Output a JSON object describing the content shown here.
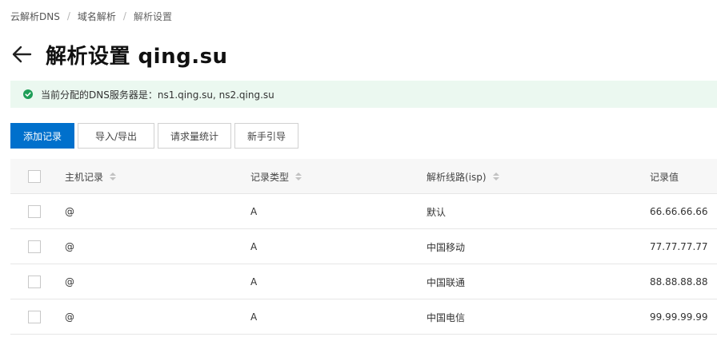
{
  "breadcrumb": {
    "items": [
      "云解析DNS",
      "域名解析",
      "解析设置"
    ],
    "separator": "/"
  },
  "header": {
    "title": "解析设置 qing.su",
    "back_icon": "arrow-left-icon"
  },
  "notice": {
    "icon": "check-circle-icon",
    "text": "当前分配的DNS服务器是：ns1.qing.su, ns2.qing.su",
    "color": "#1e9e57",
    "background": "#ebf8f0"
  },
  "toolbar": {
    "add_label": "添加记录",
    "import_export_label": "导入/导出",
    "stats_label": "请求量统计",
    "guide_label": "新手引导",
    "primary_color": "#0070cc"
  },
  "table": {
    "columns": {
      "host": "主机记录",
      "type": "记录类型",
      "line": "解析线路(isp)",
      "value": "记录值"
    },
    "rows": [
      {
        "host": "@",
        "type": "A",
        "line": "默认",
        "value": "66.66.66.66"
      },
      {
        "host": "@",
        "type": "A",
        "line": "中国移动",
        "value": "77.77.77.77"
      },
      {
        "host": "@",
        "type": "A",
        "line": "中国联通",
        "value": "88.88.88.88"
      },
      {
        "host": "@",
        "type": "A",
        "line": "中国电信",
        "value": "99.99.99.99"
      }
    ]
  }
}
